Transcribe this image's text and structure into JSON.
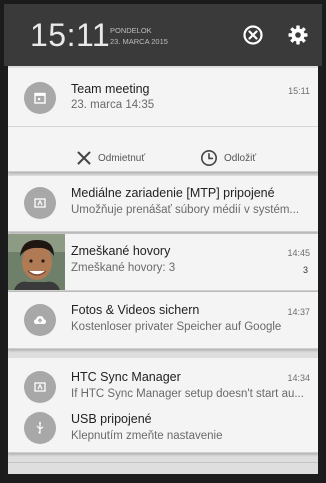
{
  "status": {
    "time": "15:11",
    "day": "PONDELOK",
    "date": "23. MARCA 2015"
  },
  "notifications": [
    {
      "id": "team-meeting",
      "title": "Team meeting",
      "subtitle": "23. marca 14:35",
      "time": "15:11",
      "actions": [
        {
          "label": "Odmietnuť",
          "icon": "close-icon"
        },
        {
          "label": "Odložiť",
          "icon": "clock-icon"
        }
      ]
    },
    {
      "id": "mtp",
      "title": "Mediálne zariadenie [MTP] pripojené",
      "subtitle": "Umožňuje prenášať súbory médií v systém..."
    },
    {
      "id": "missed-calls",
      "title": "Zmeškané hovory",
      "subtitle": "Zmeškané hovory: 3",
      "time": "14:45",
      "count": "3"
    },
    {
      "id": "fotos",
      "title": "Fotos & Videos sichern",
      "subtitle": "Kostenloser privater Speicher auf Google",
      "time": "14:37"
    },
    {
      "id": "htc-sync",
      "title": "HTC Sync Manager",
      "subtitle": "If HTC Sync Manager setup doesn't start au...",
      "time": "14:34"
    },
    {
      "id": "usb",
      "title": "USB pripojené",
      "subtitle": "Klepnutím zmeňte nastavenie"
    }
  ],
  "colors": {
    "statusbar": "#3a3a3a",
    "card": "#f4f4f4",
    "icon_circle": "#a8a8a8"
  }
}
